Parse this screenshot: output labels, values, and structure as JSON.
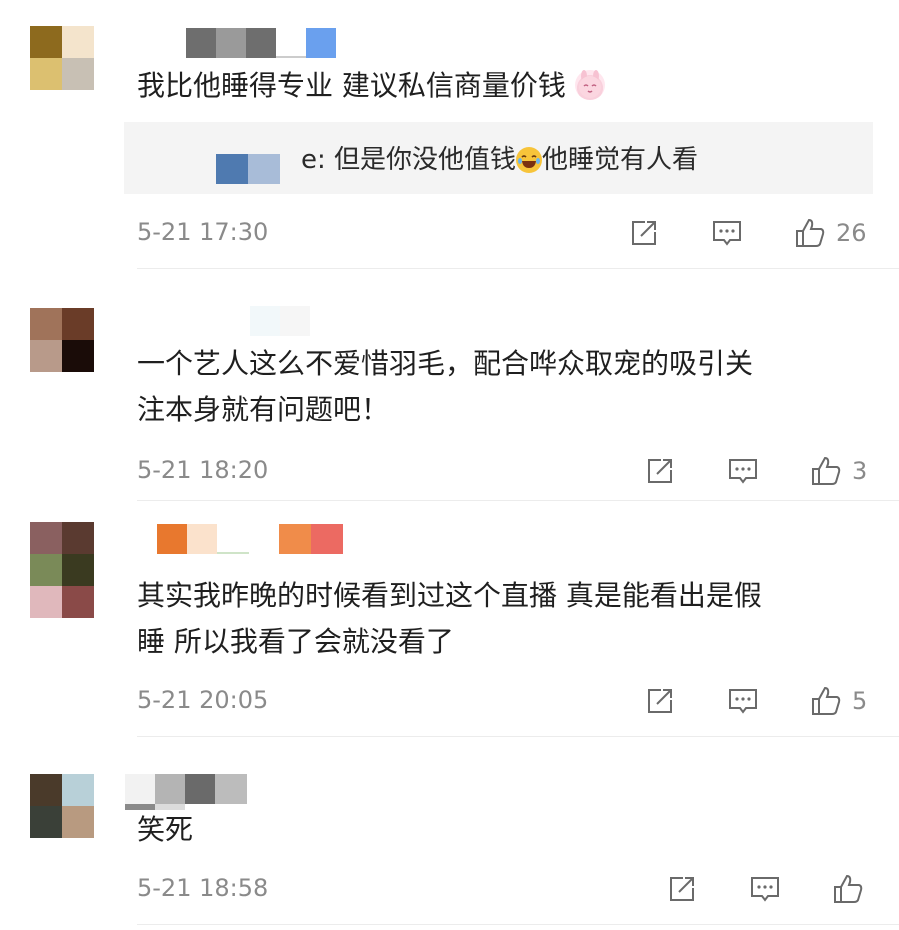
{
  "comments": [
    {
      "text": "我比他睡得专业 建议私信商量价钱",
      "reply_text": "e: 但是你没他值钱",
      "reply_text_tail": "他睡觉有人看",
      "time": "5-21 17:30",
      "likes": "26",
      "avatar_colors": [
        "#8d6a1e",
        "#f4e4cc",
        "#dcc070",
        "#c8c0b4"
      ]
    },
    {
      "text_line1": "一个艺人这么不爱惜羽毛，配合哗众取宠的吸引关",
      "text_line2": "注本身就有问题吧！",
      "time": "5-21 18:20",
      "likes": "3",
      "avatar_colors": [
        "#a0735a",
        "#6a3c28",
        "#b89a8a",
        "#1a0c08"
      ]
    },
    {
      "text_line1": "其实我昨晚的时候看到过这个直播 真是能看出是假",
      "text_line2": "睡 所以我看了会就没看了",
      "time": "5-21 20:05",
      "likes": "5",
      "avatar_colors": [
        "#8a6060",
        "#5a3a30",
        "#7a8a58",
        "#3a3a20",
        "#e0b8bc",
        "#8a4a48"
      ]
    },
    {
      "text": "笑死",
      "time": "5-21 18:58",
      "likes": "",
      "avatar_colors": [
        "#4a3a2a",
        "#b8d0d8",
        "#3a4038",
        "#b89a80"
      ]
    }
  ],
  "icons": {
    "share": "share-icon",
    "comment": "comment-icon",
    "like": "thumbs-up-icon",
    "reply_emoji": "laughing-emoji-icon",
    "name_emoji": "bunny-emoji-icon"
  }
}
